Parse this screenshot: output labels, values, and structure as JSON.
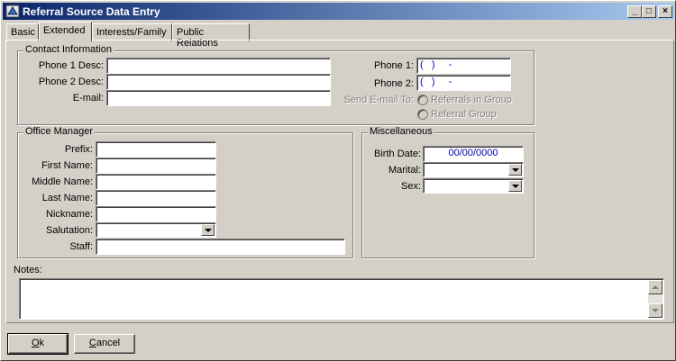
{
  "window": {
    "title": "Referral Source Data Entry"
  },
  "tabs": [
    "Basic",
    "Extended",
    "Interests/Family",
    "Public Relations"
  ],
  "contact": {
    "legend": "Contact Information",
    "phone1_desc_label": "Phone 1 Desc:",
    "phone2_desc_label": "Phone 2 Desc:",
    "email_label": "E-mail:",
    "phone1_label": "Phone 1:",
    "phone2_label": "Phone 2:",
    "phone1_value": "(   )     -",
    "phone2_value": "(   )     -",
    "send_email_label": "Send E-mail To:",
    "radio_option1": "Referrals in Group",
    "radio_option2": "Referral Group"
  },
  "office_manager": {
    "legend": "Office Manager",
    "prefix_label": "Prefix:",
    "first_name_label": "First Name:",
    "middle_name_label": "Middle Name:",
    "last_name_label": "Last Name:",
    "nickname_label": "Nickname:",
    "salutation_label": "Salutation:",
    "staff_label": "Staff:"
  },
  "misc": {
    "legend": "Miscellaneous",
    "birth_date_label": "Birth Date:",
    "birth_date_value": "00/00/0000",
    "marital_label": "Marital:",
    "sex_label": "Sex:"
  },
  "notes": {
    "label": "Notes:"
  },
  "buttons": {
    "ok": "Ok",
    "cancel": "Cancel"
  }
}
